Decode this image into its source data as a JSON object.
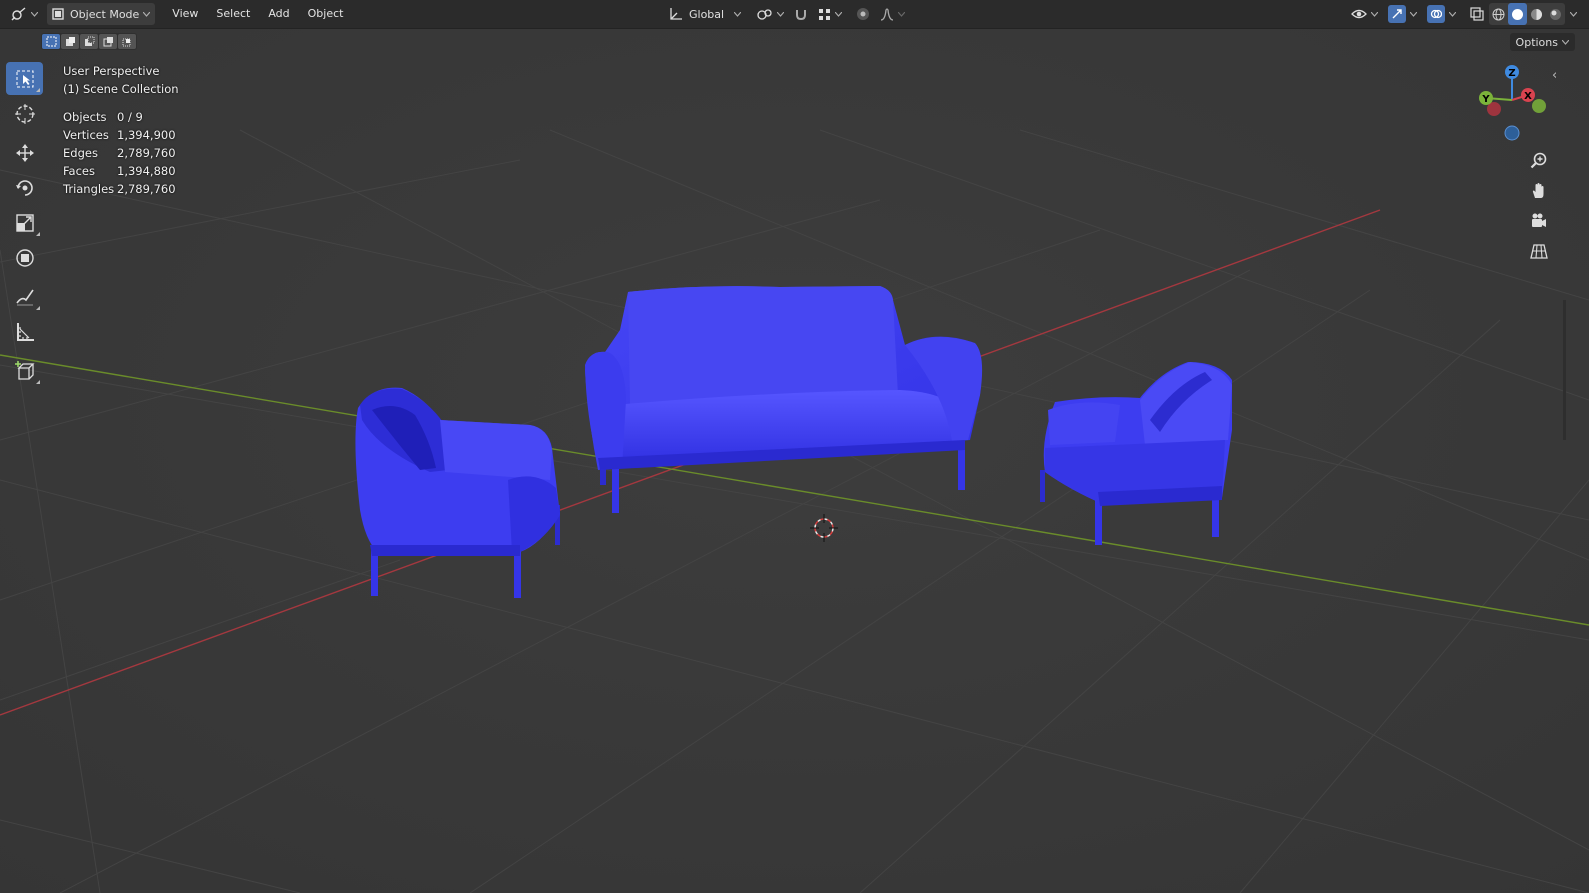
{
  "header": {
    "editor_icon": "viewport-editor-icon",
    "mode": "Object Mode",
    "menus": [
      "View",
      "Select",
      "Add",
      "Object"
    ],
    "orientation": "Global",
    "options_label": "Options"
  },
  "overlay": {
    "view_name": "User Perspective",
    "collection": "(1) Scene Collection",
    "stats": [
      {
        "label": "Objects",
        "value": "0 / 9"
      },
      {
        "label": "Vertices",
        "value": "1,394,900"
      },
      {
        "label": "Edges",
        "value": "2,789,760"
      },
      {
        "label": "Faces",
        "value": "1,394,880"
      },
      {
        "label": "Triangles",
        "value": "2,789,760"
      }
    ]
  },
  "gizmo": {
    "x_label": "X",
    "y_label": "Y",
    "z_label": "Z"
  },
  "tools": [
    "select-box",
    "cursor",
    "move",
    "rotate",
    "scale",
    "transform",
    "annotate",
    "measure",
    "add-cube"
  ],
  "colors": {
    "viewport_bg": "#3a3a3a",
    "header_bg": "#2b2b2b",
    "accent": "#4772b3",
    "mesh": "#3d3df0",
    "x_axis": "#a4383f",
    "y_axis": "#6a8c2a",
    "grid": "#444444"
  }
}
